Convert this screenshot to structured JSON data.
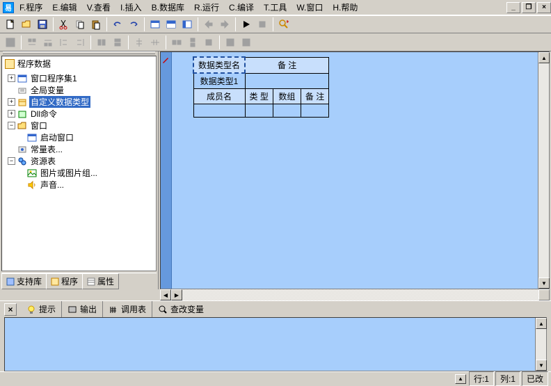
{
  "menu": {
    "items": [
      "F.程序",
      "E.编辑",
      "V.查看",
      "I.插入",
      "B.数据库",
      "R.运行",
      "C.编译",
      "T.工具",
      "W.窗口",
      "H.帮助"
    ]
  },
  "tree": {
    "title": "程序数据",
    "n0": {
      "label": "窗口程序集1"
    },
    "n1": {
      "label": "全局变量"
    },
    "n2": {
      "label": "自定义数据类型"
    },
    "n3": {
      "label": "Dll命令"
    },
    "n4": {
      "label": "窗口"
    },
    "n4a": {
      "label": "启动窗口"
    },
    "n5": {
      "label": "常量表..."
    },
    "n6": {
      "label": "资源表"
    },
    "n6a": {
      "label": "图片或图片组..."
    },
    "n6b": {
      "label": "声音..."
    }
  },
  "sidetabs": {
    "t0": "支持库",
    "t1": "程序",
    "t2": "属性"
  },
  "grid": {
    "r0c0": "数据类型名",
    "r0c1": "备 注",
    "r1c0": "数据类型1",
    "r2c0": "成员名",
    "r2c1": "类 型",
    "r2c2": "数组",
    "r2c3": "备 注"
  },
  "bottomtabs": {
    "t0": "提示",
    "t1": "输出",
    "t2": "调用表",
    "t3": "查改变量"
  },
  "status": {
    "row": "行:1",
    "col": "列:1",
    "mod": "已改"
  }
}
